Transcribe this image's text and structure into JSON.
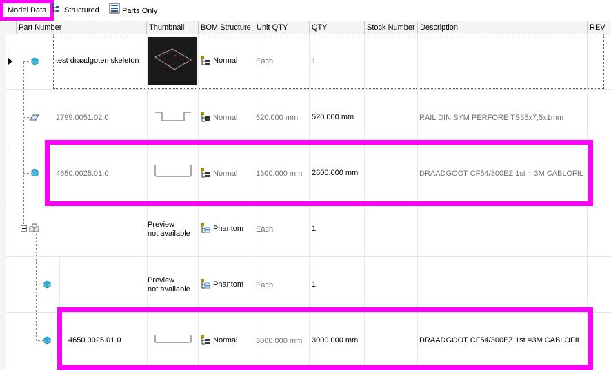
{
  "tabs": [
    {
      "label": "Model Data",
      "icon": "none",
      "active": true
    },
    {
      "label": "Structured",
      "icon": "structured-icon"
    },
    {
      "label": "Parts Only",
      "icon": "parts-only-icon"
    }
  ],
  "columns": [
    "Part Number",
    "Thumbnail",
    "BOM Structure",
    "Unit QTY",
    "QTY",
    "Stock Number",
    "Description",
    "REV"
  ],
  "rows": [
    {
      "part": "test draadgoten skeleton",
      "thumb": "image",
      "bom": "Normal",
      "unit_qty": "Each",
      "qty": "1",
      "stock": "",
      "desc": "",
      "rev": ""
    },
    {
      "part": "2799.0051.02.0",
      "thumb": "profile-rail",
      "bom": "Normal",
      "unit_qty": "520.000 mm",
      "qty": "520.000 mm",
      "stock": "",
      "desc": "RAIL DIN SYM PERFORE TS35x7,5x1mm",
      "rev": ""
    },
    {
      "part": "4650.0025.01.0",
      "thumb": "profile-u",
      "bom": "Normal",
      "unit_qty": "1300.000 mm",
      "qty": "2600.000 mm",
      "stock": "",
      "desc": "DRAADGOOT CF54/300EZ  1st = 3M   CABLOFIL",
      "rev": ""
    },
    {
      "part": "",
      "thumb": "none",
      "thumb_text": [
        "Preview",
        "not available"
      ],
      "bom": "Phantom",
      "unit_qty": "Each",
      "qty": "1",
      "stock": "",
      "desc": "",
      "rev": ""
    },
    {
      "part": "",
      "thumb": "none",
      "thumb_text": [
        "Preview",
        "not available"
      ],
      "bom": "Phantom",
      "unit_qty": "Each",
      "qty": "1",
      "stock": "",
      "desc": "",
      "rev": ""
    },
    {
      "part": "4650.0025.01.0",
      "thumb": "profile-u-flat",
      "bom": "Normal",
      "unit_qty": "3000.000 mm",
      "qty": "3000.000 mm",
      "stock": "",
      "desc": "DRAADGOOT CF54/300EZ  1st =3M CABLOFIL",
      "rev": ""
    }
  ],
  "colors": {
    "highlight": "#ff00ff",
    "cube": "#4cc3e8",
    "grid": "#e4e4e4"
  }
}
